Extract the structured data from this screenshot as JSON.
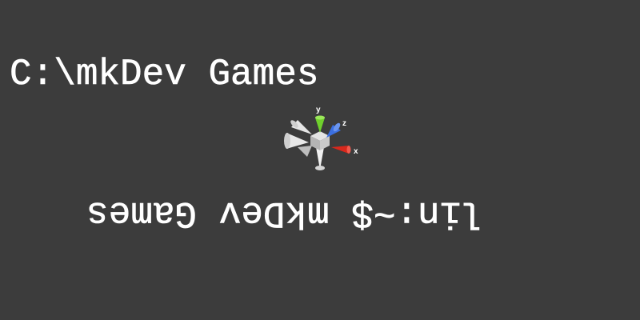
{
  "window_title_line": "C:\\mkDev Games",
  "mirrored_line": "lin:~$ mkDev Games",
  "gizmo": {
    "axis_labels": {
      "y": "y",
      "z": "z",
      "x": "x"
    },
    "colors": {
      "y_axis": "#6fd02c",
      "z_axis": "#3b6fe0",
      "x_axis": "#d8281c",
      "neutral": "#d9d9d9",
      "background": "#3c3c3c"
    }
  }
}
